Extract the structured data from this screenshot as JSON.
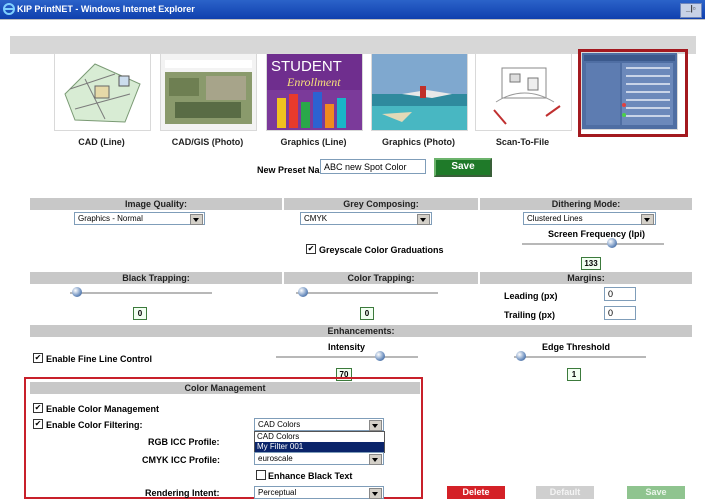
{
  "window": {
    "title": "KIP PrintNET - Windows Internet Explorer"
  },
  "presets": [
    {
      "label": "CAD (Line)",
      "icon": "cad-line-thumbnail"
    },
    {
      "label": "CAD/GIS (Photo)",
      "icon": "cad-gis-photo-thumbnail"
    },
    {
      "label": "Graphics (Line)",
      "icon": "graphics-line-thumbnail",
      "thumb_text_1": "STUDENT",
      "thumb_text_2": "Enrollment"
    },
    {
      "label": "Graphics (Photo)",
      "icon": "graphics-photo-thumbnail"
    },
    {
      "label": "Scan-To-File",
      "icon": "scan-to-file-thumbnail"
    },
    {
      "label": "",
      "icon": "custom-preset-thumbnail"
    }
  ],
  "new_preset": {
    "label": "New Preset Name:",
    "value": "ABC new Spot Color",
    "save_label": "Save"
  },
  "image_quality": {
    "label": "Image Quality:",
    "value": "Graphics - Normal"
  },
  "grey_composing": {
    "label": "Grey Composing:",
    "value": "CMYK",
    "greyscale_grad_label": "Greyscale Color Graduations",
    "greyscale_grad_checked": true
  },
  "dithering": {
    "label": "Dithering Mode:",
    "value": "Clustered Lines",
    "screen_freq_label": "Screen Frequency (lpi)",
    "screen_freq_value": "133"
  },
  "black_trapping": {
    "label": "Black Trapping:",
    "value": "0"
  },
  "color_trapping": {
    "label": "Color Trapping:",
    "value": "0"
  },
  "margins": {
    "label": "Margins:",
    "leading_label": "Leading (px)",
    "leading_value": "0",
    "trailing_label": "Trailing (px)",
    "trailing_value": "0"
  },
  "enhancements": {
    "label": "Enhancements:",
    "fine_line_label": "Enable Fine Line Control",
    "fine_line_checked": true,
    "intensity_label": "Intensity",
    "intensity_value": "70",
    "edge_label": "Edge Threshold",
    "edge_value": "1"
  },
  "color_management": {
    "label": "Color Management",
    "enable_label": "Enable Color Management",
    "enable_checked": true,
    "filtering_label": "Enable Color Filtering:",
    "filtering_checked": true,
    "filtering_value": "CAD Colors",
    "filter_options": [
      "CAD Colors",
      "My Filter 001"
    ],
    "rgb_label": "RGB ICC Profile:",
    "cmyk_label": "CMYK ICC Profile:",
    "cmyk_value": "euroscale",
    "enhance_black_label": "Enhance Black Text",
    "enhance_black_checked": false,
    "intent_label": "Rendering Intent:",
    "intent_value": "Perceptual"
  },
  "actions": {
    "delete_label": "Delete",
    "default_label": "Default",
    "save_label": "Save"
  },
  "colors": {
    "bar": "#c8c8c8",
    "accent_green": "#1f7a29",
    "highlight_red": "#c8202a",
    "delete_red": "#d42127"
  }
}
